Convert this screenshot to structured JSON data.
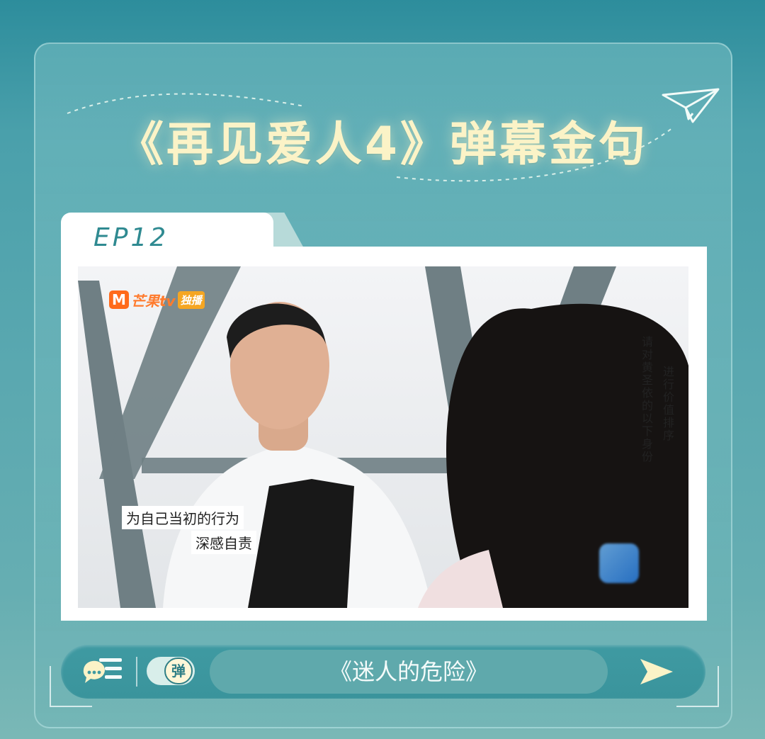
{
  "title": "《再见爱人4》弹幕金句",
  "episode_label": "EP12",
  "video": {
    "logo_text": "芒果tv",
    "logo_badge": "独播",
    "caption_vertical_1": "请对黄圣依的以下身份",
    "caption_vertical_2": "进行价值排序",
    "subtitle_line_1": "为自己当初的行为",
    "subtitle_line_2": "深感自责"
  },
  "danmaku_bar": {
    "toggle_label": "弹",
    "input_text": "《迷人的危险》"
  },
  "icons": {
    "chat": "chat-bubble-icon",
    "send": "send-arrow-icon",
    "plane": "paper-plane-icon"
  },
  "colors": {
    "title": "#fbf3c7",
    "episode": "#2f8a91",
    "bar": "#3f9aa2",
    "pill": "#5fa9ac"
  }
}
